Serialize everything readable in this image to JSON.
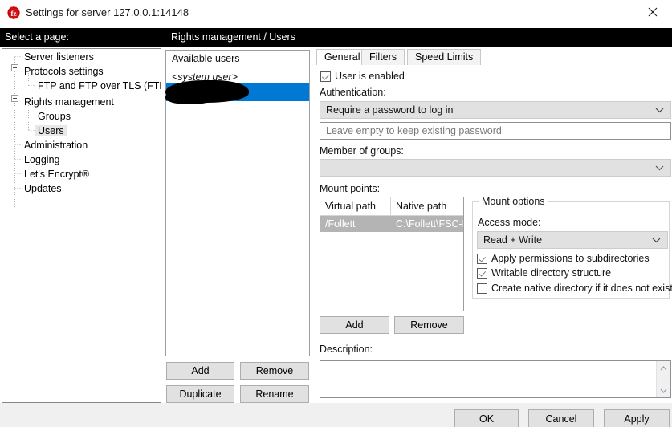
{
  "window": {
    "title": "Settings for server 127.0.0.1:14148",
    "icon": "filezilla-icon",
    "close_label": "✕"
  },
  "headers": {
    "left": "Select a page:",
    "right": "Rights management / Users"
  },
  "tree": {
    "items": [
      {
        "label": "Server listeners",
        "indent": 0,
        "expander": false,
        "selected": false
      },
      {
        "label": "Protocols settings",
        "indent": 0,
        "expander": true,
        "selected": false
      },
      {
        "label": "FTP and FTP over TLS (FTPS)",
        "indent": 1,
        "expander": false,
        "selected": false
      },
      {
        "label": "Rights management",
        "indent": 0,
        "expander": true,
        "selected": false
      },
      {
        "label": "Groups",
        "indent": 1,
        "expander": false,
        "selected": false
      },
      {
        "label": "Users",
        "indent": 1,
        "expander": false,
        "selected": true
      },
      {
        "label": "Administration",
        "indent": 0,
        "expander": false,
        "selected": false
      },
      {
        "label": "Logging",
        "indent": 0,
        "expander": false,
        "selected": false
      },
      {
        "label": "Let's Encrypt®",
        "indent": 0,
        "expander": false,
        "selected": false
      },
      {
        "label": "Updates",
        "indent": 0,
        "expander": false,
        "selected": false
      }
    ]
  },
  "users_panel": {
    "title": "Available users",
    "items": [
      {
        "label": "<system user>",
        "selected": false,
        "redacted": false
      },
      {
        "label": "",
        "selected": true,
        "redacted": true
      }
    ],
    "buttons": {
      "add": "Add",
      "remove": "Remove",
      "duplicate": "Duplicate",
      "rename": "Rename"
    }
  },
  "tabs": [
    {
      "label": "General",
      "active": true
    },
    {
      "label": "Filters",
      "active": false
    },
    {
      "label": "Speed Limits",
      "active": false
    }
  ],
  "general": {
    "user_enabled": {
      "label": "User is enabled",
      "checked": true
    },
    "authentication_label": "Authentication:",
    "authentication_value": "Require a password to log in",
    "password_placeholder": "Leave empty to keep existing password",
    "password_value": "",
    "member_of_groups_label": "Member of groups:",
    "member_of_groups_value": "",
    "mount_points_label": "Mount points:",
    "mount_table": {
      "columns": [
        "Virtual path",
        "Native path"
      ],
      "rows": [
        {
          "virtual_path": "/Follett",
          "native_path": "C:\\Follett\\FSC-P",
          "selected": true
        }
      ]
    },
    "mount_options": {
      "legend": "Mount options",
      "access_mode_label": "Access mode:",
      "access_mode_value": "Read + Write",
      "checkboxes": [
        {
          "label": "Apply permissions to subdirectories",
          "checked": true
        },
        {
          "label": "Writable directory structure",
          "checked": true
        },
        {
          "label": "Create native directory if it does not exist",
          "checked": false
        }
      ]
    },
    "mount_buttons": {
      "add": "Add",
      "remove": "Remove"
    },
    "description_label": "Description:",
    "description_value": ""
  },
  "footer": {
    "ok": "OK",
    "cancel": "Cancel",
    "apply": "Apply"
  },
  "colors": {
    "selection_blue": "#0078d4",
    "header_black": "#000000",
    "button_face": "#e1e1e1",
    "inactive_selection": "#b4b4b4"
  }
}
